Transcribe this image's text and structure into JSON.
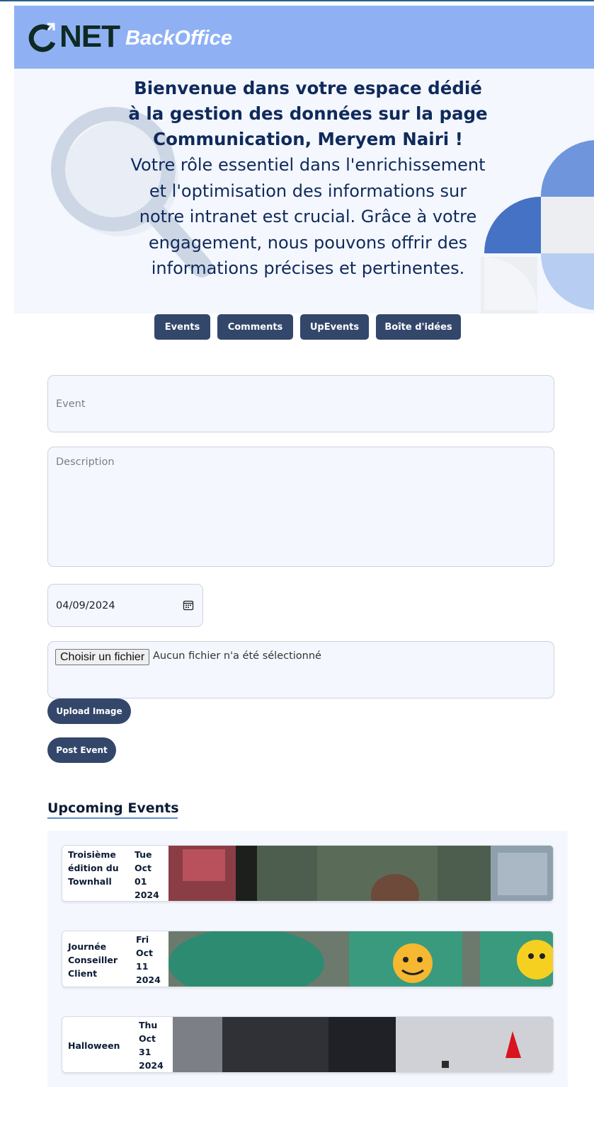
{
  "brand": {
    "logo_text": "NET",
    "suffix": "BackOffice"
  },
  "hero": {
    "title": "Bienvenue dans votre espace dédié à la gestion des données sur la page Communication, Meryem Nairi !",
    "body": "Votre rôle essentiel dans l'enrichissement et l'optimisation des informations sur notre intranet est crucial. Grâce à votre engagement, nous pouvons offrir des informations précises et pertinentes."
  },
  "tabs": [
    {
      "label": "Events"
    },
    {
      "label": "Comments"
    },
    {
      "label": "UpEvents"
    },
    {
      "label": "Boîte d'idées"
    }
  ],
  "form": {
    "event_placeholder": "Event",
    "description_placeholder": "Description",
    "date_value": "04/09/2024",
    "file_button": "Choisir un fichier",
    "file_status": "Aucun fichier n'a été sélectionné",
    "upload_label": "Upload Image",
    "post_label": "Post Event"
  },
  "upcoming": {
    "title": "Upcoming Events",
    "events": [
      {
        "name": "Troisième édition du Townhall",
        "date": "Tue Oct 01 2024"
      },
      {
        "name": "Journée Conseiller Client",
        "date": "Fri Oct 11 2024"
      },
      {
        "name": "Halloween",
        "date": "Thu Oct 31 2024"
      }
    ]
  },
  "colors": {
    "header_bg": "#8fb1f4",
    "hero_bg": "#f4f7fd",
    "button_bg": "#33476b",
    "title_text": "#0f2a5c",
    "accent": "#5b8ed6"
  }
}
